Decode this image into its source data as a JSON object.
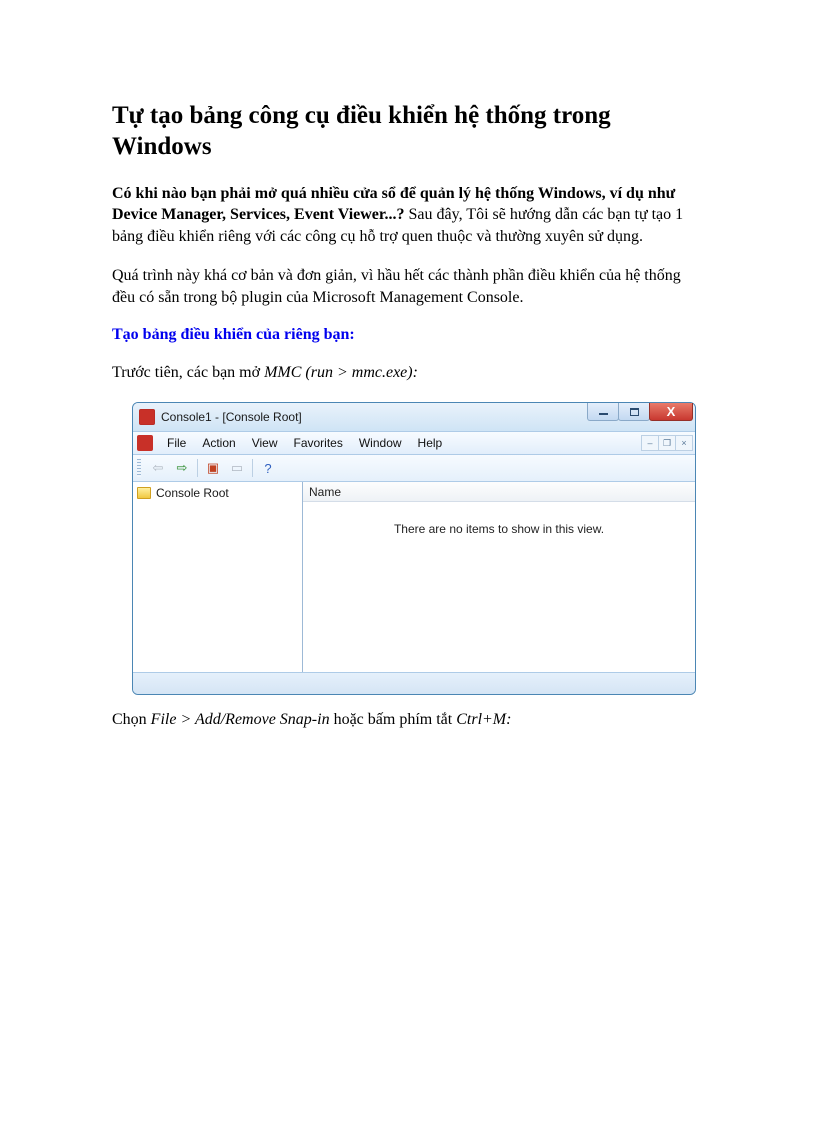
{
  "article": {
    "title": "Tự tạo bảng công cụ điều khiển hệ thống trong Windows",
    "lead_bold": "Có khi nào bạn phải mở quá nhiều cửa sổ để quản lý hệ thống Windows, ví dụ như Device Manager, Services, Event Viewer...?",
    "lead_rest": " Sau đây, Tôi sẽ hướng dẫn các bạn tự tạo 1 bảng điều khiển riêng với các công cụ hỗ trợ quen thuộc và thường xuyên sử dụng.",
    "para2": "Quá trình này khá cơ bản và đơn giản, vì hầu hết các thành phần điều khiển của hệ thống đều có sẵn trong bộ plugin của Microsoft Management Console.",
    "section_heading": "Tạo bảng điều khiển của riêng bạn:",
    "para3_pre": "Trước tiên, các bạn mở ",
    "para3_italic": "MMC (run > mmc.exe):",
    "para4_pre": "Chọn ",
    "para4_it1": "File > Add/Remove Snap-in",
    "para4_mid": " hoặc bấm phím tắt ",
    "para4_it2": "Ctrl+M:"
  },
  "mmc": {
    "title": "Console1 - [Console Root]",
    "menu": {
      "file": "File",
      "action": "Action",
      "view": "View",
      "favorites": "Favorites",
      "window": "Window",
      "help": "Help"
    },
    "tree_root": "Console Root",
    "list_header": "Name",
    "empty_text": "There are no items to show in this view."
  },
  "icons": {
    "app_icon": "mmc-red-toolbox-icon",
    "folder": "folder-icon"
  }
}
